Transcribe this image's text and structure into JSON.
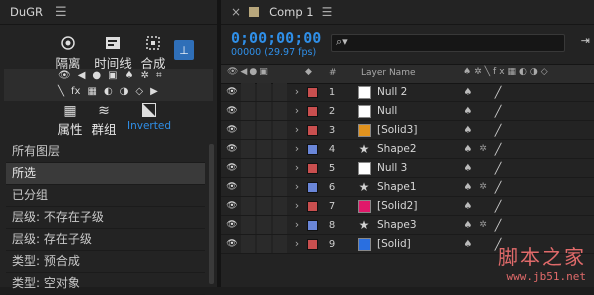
{
  "left_panel": {
    "title": "DuGR",
    "menu_icon": "hamburger-icon",
    "mode_buttons": [
      {
        "label": "隔离",
        "icon": "isolate-icon"
      },
      {
        "label": "时间线",
        "icon": "timeline-icon"
      },
      {
        "label": "合成",
        "icon": "comp-icon"
      }
    ],
    "inverted_label": "Inverted",
    "tabs": [
      "属性",
      "群组"
    ],
    "list_items": [
      "所有图层",
      "所选",
      "已分组",
      "层级: 不存在子级",
      "层级: 存在子级",
      "类型: 预合成",
      "类型: 空对象"
    ],
    "selected_index": 1
  },
  "timeline": {
    "tab_close": "×",
    "tab_title": "Comp 1",
    "timecode": "0;00;00;00",
    "fps": "00000 (29.97 fps)",
    "search_icon": "search-icon",
    "col_num": "#",
    "col_layer_name": "Layer Name",
    "layers": [
      {
        "num": "1",
        "name": "Null 2",
        "label_color": "#c94f4f",
        "swatch": "#ffffff",
        "star": false,
        "fx": false
      },
      {
        "num": "2",
        "name": "Null",
        "label_color": "#c94f4f",
        "swatch": "#ffffff",
        "star": false,
        "fx": false
      },
      {
        "num": "3",
        "name": "[Solid3]",
        "label_color": "#c94f4f",
        "swatch": "#e0921e",
        "star": false,
        "fx": false
      },
      {
        "num": "4",
        "name": "Shape2",
        "label_color": "#6a86d8",
        "swatch": "",
        "star": true,
        "fx": true
      },
      {
        "num": "5",
        "name": "Null 3",
        "label_color": "#c94f4f",
        "swatch": "#ffffff",
        "star": false,
        "fx": false
      },
      {
        "num": "6",
        "name": "Shape1",
        "label_color": "#6a86d8",
        "swatch": "",
        "star": true,
        "fx": true
      },
      {
        "num": "7",
        "name": "[Solid2]",
        "label_color": "#c94f4f",
        "swatch": "#e0196a",
        "star": false,
        "fx": false
      },
      {
        "num": "8",
        "name": "Shape3",
        "label_color": "#6a86d8",
        "swatch": "",
        "star": true,
        "fx": true
      },
      {
        "num": "9",
        "name": "[Solid]",
        "label_color": "#c94f4f",
        "swatch": "#2a6fe0",
        "star": false,
        "fx": false
      }
    ]
  },
  "watermark": {
    "line1": "脚本之家",
    "line2": "www.jb51.net"
  },
  "colors": {
    "accent": "#2f8fe8",
    "panel": "#232323",
    "selected_row": "#3a3a3a"
  }
}
